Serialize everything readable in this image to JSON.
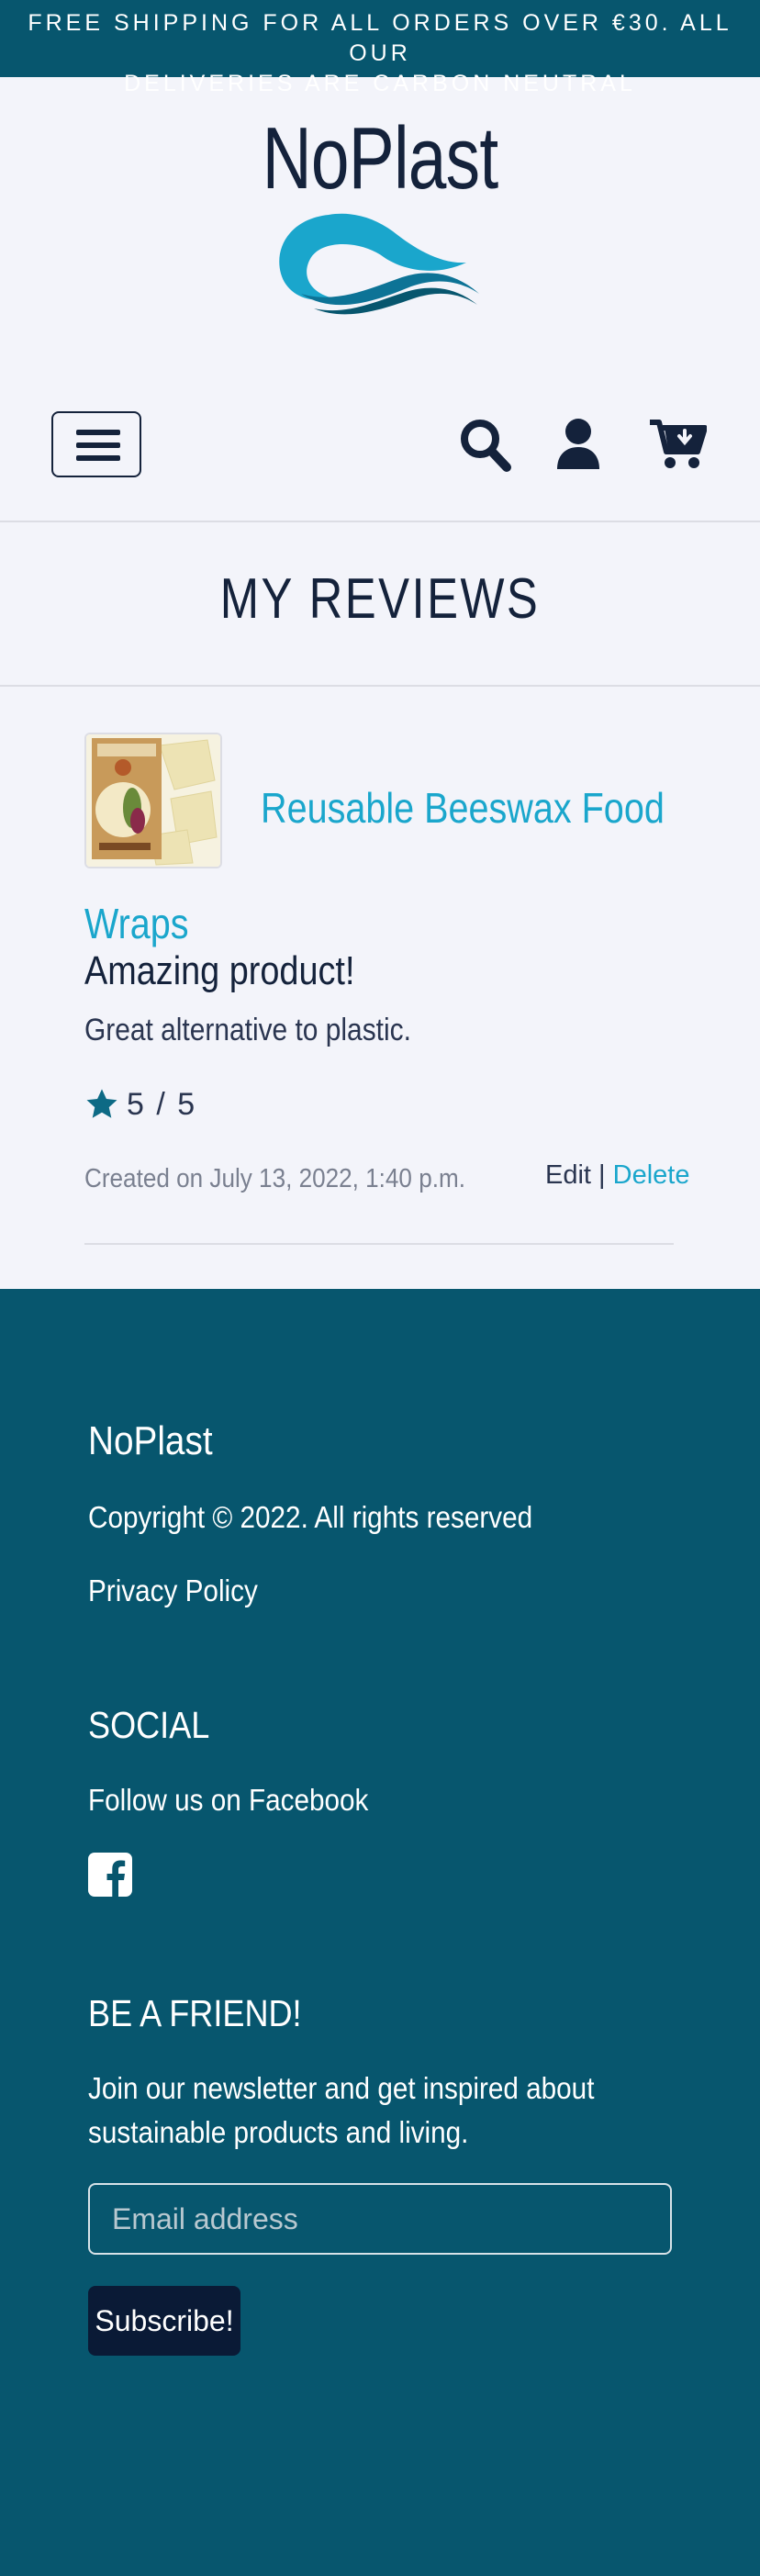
{
  "banner": {
    "line1": "FREE SHIPPING FOR ALL ORDERS OVER €30. ALL OUR",
    "line2": "DELIVERIES ARE CARBON NEUTRAL"
  },
  "header": {
    "brand": "NoPlast",
    "icons": [
      "menu-icon",
      "search-icon",
      "user-icon",
      "cart-icon"
    ]
  },
  "page": {
    "title": "MY REVIEWS"
  },
  "review": {
    "product_name_line1": "Reusable Beeswax Food",
    "product_name_line2": "Wraps",
    "title": "Amazing product!",
    "body": "Great alternative to plastic.",
    "rating": "5 / 5",
    "created": "Created on July 13, 2022, 1:40 p.m.",
    "edit_label": "Edit",
    "separator": "|",
    "delete_label": "Delete"
  },
  "footer": {
    "brand": "NoPlast",
    "copyright": "Copyright © 2022. All rights reserved",
    "privacy": "Privacy Policy",
    "social_heading": "SOCIAL",
    "follow": "Follow us on Facebook",
    "friend_heading": "BE A FRIEND!",
    "newsletter_line1": "Join our newsletter and get inspired about",
    "newsletter_line2": "sustainable products and living.",
    "email_placeholder": "Email address",
    "subscribe_label": "Subscribe!"
  },
  "colors": {
    "accent": "#1aa6cc",
    "brand_dark": "#14223b",
    "footer_bg": "#07566e",
    "page_bg": "#f3f4fa"
  }
}
